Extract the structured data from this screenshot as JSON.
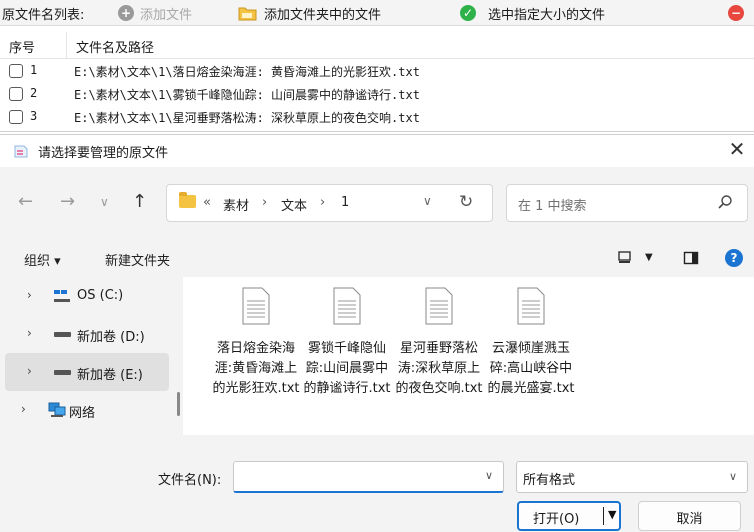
{
  "app": {
    "list_label": "原文件名列表:",
    "add_file": "添加文件",
    "add_folder_files": "添加文件夹中的文件",
    "select_size": "选中指定大小的文件",
    "columns": {
      "index": "序号",
      "path": "文件名及路径"
    },
    "rows": [
      {
        "index": "1",
        "path": "E:\\素材\\文本\\1\\落日熔金染海涯: 黄昏海滩上的光影狂欢.txt"
      },
      {
        "index": "2",
        "path": "E:\\素材\\文本\\1\\雾锁千峰隐仙踪: 山间晨雾中的静谧诗行.txt"
      },
      {
        "index": "3",
        "path": "E:\\素材\\文本\\1\\星河垂野落松涛: 深秋草原上的夜色交响.txt"
      }
    ],
    "colors": {
      "add_file_icon": "#9a9a9a",
      "select_icon": "#2fb14a",
      "remove_icon": "#e8473f"
    }
  },
  "dialog": {
    "title": "请选择要管理的原文件",
    "breadcrumb": [
      "素材",
      "文本",
      "1"
    ],
    "breadcrumb_prefix": "«",
    "search_placeholder": "在 1 中搜索",
    "organize": "组织 ▾",
    "new_folder": "新建文件夹",
    "help": "?",
    "nav": [
      {
        "label": "OS (C:)",
        "icon": "os-drive-icon"
      },
      {
        "label": "新加卷 (D:)",
        "icon": "drive-icon"
      },
      {
        "label": "新加卷 (E:)",
        "icon": "drive-icon",
        "selected": true
      },
      {
        "label": "网络",
        "icon": "network-icon"
      }
    ],
    "files": [
      "落日熔金染海涯:黄昏海滩上的光影狂欢.txt",
      "雾锁千峰隐仙踪:山间晨雾中的静谧诗行.txt",
      "星河垂野落松涛:深秋草原上的夜色交响.txt",
      "云瀑倾崖溅玉碎:高山峡谷中的晨光盛宴.txt"
    ],
    "filename_label": "文件名(N):",
    "filename_value": "",
    "filter_value": "所有格式",
    "open_label": "打开(O)",
    "cancel_label": "取消"
  }
}
